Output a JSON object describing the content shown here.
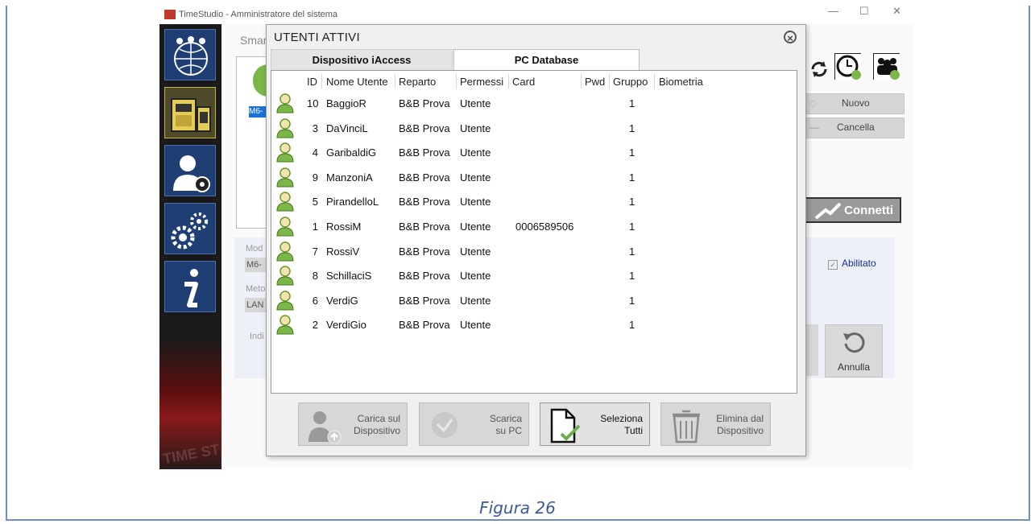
{
  "window": {
    "title": "TimeStudio - Amministratore del sistema",
    "controls": [
      "—",
      "☐",
      "✕"
    ]
  },
  "top_caption": "",
  "background": {
    "smart_label": "Smar",
    "selected_item": "M6-",
    "mod_label": "Mod",
    "mod_value": "M6-",
    "met_label": "Meto",
    "met_value": "LAN",
    "ind_label": "Indi",
    "nuovo": "Nuovo",
    "cancella": "Cancella",
    "connetti": "Connetti",
    "abilitato": "Abilitato",
    "annulla": "Annulla"
  },
  "dialog": {
    "title": "UTENTI ATTIVI",
    "tabs": [
      {
        "label": "Dispositivo iAccess",
        "active": false
      },
      {
        "label": "PC Database",
        "active": true
      }
    ],
    "columns": [
      "ID",
      "Nome Utente",
      "Reparto",
      "Permessi",
      "Card",
      "Pwd",
      "Gruppo",
      "Biometria"
    ],
    "rows": [
      {
        "id": "10",
        "name": "BaggioR",
        "reparto": "B&B Prova",
        "permessi": "Utente",
        "card": "",
        "pwd": "",
        "gruppo": "1",
        "bio": ""
      },
      {
        "id": "3",
        "name": "DaVinciL",
        "reparto": "B&B Prova",
        "permessi": "Utente",
        "card": "",
        "pwd": "",
        "gruppo": "1",
        "bio": ""
      },
      {
        "id": "4",
        "name": "GaribaldiG",
        "reparto": "B&B Prova",
        "permessi": "Utente",
        "card": "",
        "pwd": "",
        "gruppo": "1",
        "bio": ""
      },
      {
        "id": "9",
        "name": "ManzoniA",
        "reparto": "B&B Prova",
        "permessi": "Utente",
        "card": "",
        "pwd": "",
        "gruppo": "1",
        "bio": ""
      },
      {
        "id": "5",
        "name": "PirandelloL",
        "reparto": "B&B Prova",
        "permessi": "Utente",
        "card": "",
        "pwd": "",
        "gruppo": "1",
        "bio": ""
      },
      {
        "id": "1",
        "name": "RossiM",
        "reparto": "B&B Prova",
        "permessi": "Utente",
        "card": "0006589506",
        "pwd": "",
        "gruppo": "1",
        "bio": ""
      },
      {
        "id": "7",
        "name": "RossiV",
        "reparto": "B&B Prova",
        "permessi": "Utente",
        "card": "",
        "pwd": "",
        "gruppo": "1",
        "bio": ""
      },
      {
        "id": "8",
        "name": "SchillaciS",
        "reparto": "B&B Prova",
        "permessi": "Utente",
        "card": "",
        "pwd": "",
        "gruppo": "1",
        "bio": ""
      },
      {
        "id": "6",
        "name": "VerdiG",
        "reparto": "B&B Prova",
        "permessi": "Utente",
        "card": "",
        "pwd": "",
        "gruppo": "1",
        "bio": ""
      },
      {
        "id": "2",
        "name": "VerdiGio",
        "reparto": "B&B Prova",
        "permessi": "Utente",
        "card": "",
        "pwd": "",
        "gruppo": "1",
        "bio": ""
      }
    ],
    "buttons": {
      "carica_1": "Carica sul",
      "carica_2": "Dispositivo",
      "scarica_1": "Scarica",
      "scarica_2": "su PC",
      "seleziona_1": "Seleziona",
      "seleziona_2": "Tutti",
      "elimina_1": "Elimina dal",
      "elimina_2": "Dispositivo"
    }
  },
  "figure_caption": "Figura 26",
  "colors": {
    "accent_blue": "#1f3f74",
    "frame_blue": "#6d8fc2",
    "user_green": "#7ab648"
  }
}
